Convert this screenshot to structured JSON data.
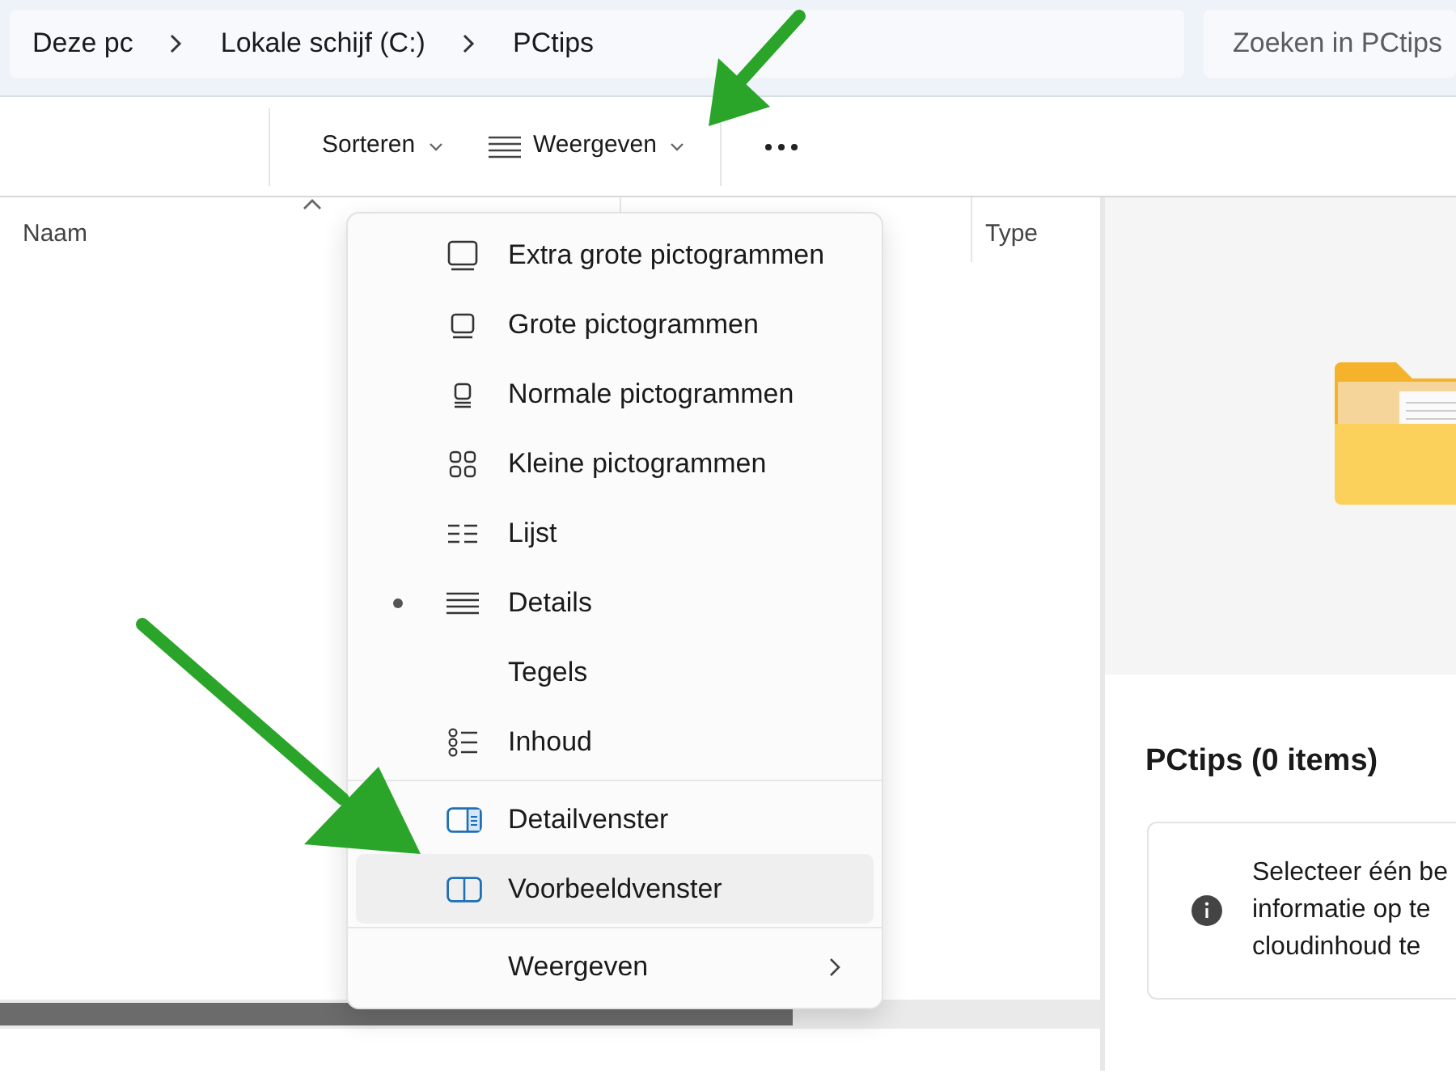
{
  "breadcrumb": [
    {
      "label": "Deze pc"
    },
    {
      "label": "Lokale schijf (C:)"
    },
    {
      "label": "PCtips"
    }
  ],
  "search": {
    "placeholder": "Zoeken in PCtips"
  },
  "toolbar": [
    {
      "label": "Sorteren",
      "kind": "dropdown"
    },
    {
      "label": "Weergeven",
      "kind": "view"
    }
  ],
  "columns": [
    {
      "label": "Naam",
      "sorted": true
    },
    {
      "label": "Type",
      "sorted": false
    }
  ],
  "view_menu": {
    "groups": [
      [
        {
          "label": "Extra grote pictogrammen",
          "selected": false,
          "hovered": false,
          "kind": "item"
        },
        {
          "label": "Grote pictogrammen",
          "selected": false,
          "hovered": false,
          "kind": "item"
        },
        {
          "label": "Normale pictogrammen",
          "selected": false,
          "hovered": false,
          "kind": "item"
        },
        {
          "label": "Kleine pictogrammen",
          "selected": false,
          "hovered": false,
          "kind": "item"
        },
        {
          "label": "Lijst",
          "selected": false,
          "hovered": false,
          "kind": "item"
        },
        {
          "label": "Details",
          "selected": true,
          "hovered": false,
          "kind": "item"
        },
        {
          "label": "Tegels",
          "selected": false,
          "hovered": false,
          "kind": "item"
        },
        {
          "label": "Inhoud",
          "selected": false,
          "hovered": false,
          "kind": "item"
        }
      ],
      [
        {
          "label": "Detailvenster",
          "selected": false,
          "hovered": false,
          "kind": "item"
        },
        {
          "label": "Voorbeeldvenster",
          "selected": false,
          "hovered": true,
          "kind": "item"
        }
      ],
      [
        {
          "label": "Weergeven",
          "selected": false,
          "hovered": false,
          "kind": "submenu"
        }
      ]
    ]
  },
  "preview": {
    "title": "PCtips (0 items)",
    "info": [
      "Selecteer één be",
      "informatie op te",
      "cloudinhoud te"
    ]
  }
}
